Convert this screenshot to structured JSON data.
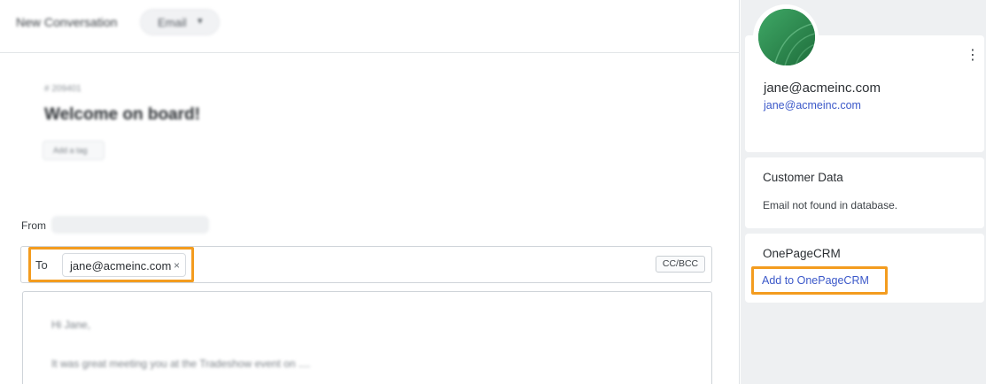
{
  "topbar": {
    "conversation_title": "New Conversation",
    "channel": "Email",
    "channel_icon": "chevron-down-icon"
  },
  "ticket": {
    "id": "# 209401",
    "subject": "Welcome on board!",
    "tag_button": "Add a tag"
  },
  "compose": {
    "from_label": "From",
    "to_label": "To",
    "recipient": "jane@acmeinc.com",
    "remove_icon": "×",
    "cc_bcc": "CC/BCC",
    "body_line1": "Hi Jane,",
    "body_line2": "It was great meeting you at the Tradeshow event on ...."
  },
  "sidebar": {
    "profile": {
      "name": "jane@acmeinc.com",
      "email": "jane@acmeinc.com",
      "menu_icon": "⋮"
    },
    "customer_data": {
      "title": "Customer Data",
      "message": "Email not found in database."
    },
    "onepagecrm": {
      "title": "OnePageCRM",
      "action": "Add to OnePageCRM"
    }
  },
  "colors": {
    "highlight": "#f39c1f",
    "link": "#3b58c9",
    "avatar": "#2a8a4e",
    "sidebar_bg": "#eef0f2"
  }
}
